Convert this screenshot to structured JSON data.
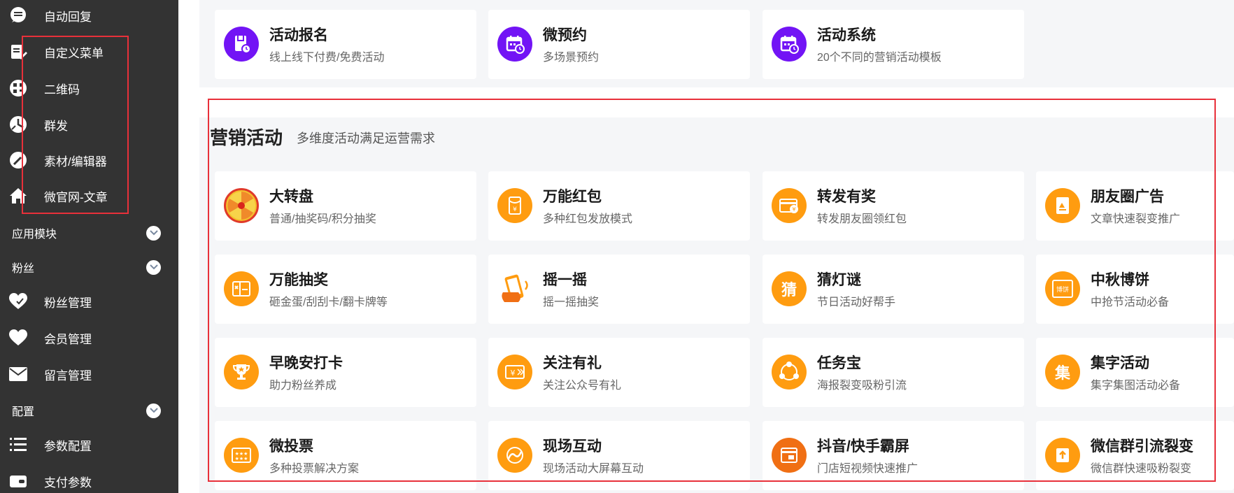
{
  "sidebar": {
    "items_top": [
      {
        "label": "自动回复",
        "icon": "message-icon"
      },
      {
        "label": "自定义菜单",
        "icon": "edit-doc-icon"
      },
      {
        "label": "二维码",
        "icon": "qrcode-icon"
      },
      {
        "label": "群发",
        "icon": "broadcast-icon"
      },
      {
        "label": "素材/编辑器",
        "icon": "pen-icon"
      },
      {
        "label": "微官网-文章",
        "icon": "home-icon"
      }
    ],
    "sections": {
      "app_modules": "应用模块",
      "fans": "粉丝",
      "config": "配置"
    },
    "fans_items": [
      {
        "label": "粉丝管理",
        "icon": "heart-check-icon"
      },
      {
        "label": "会员管理",
        "icon": "heart-icon"
      },
      {
        "label": "留言管理",
        "icon": "mail-icon"
      }
    ],
    "config_items": [
      {
        "label": "参数配置",
        "icon": "list-icon"
      },
      {
        "label": "支付参数",
        "icon": "wallet-icon"
      }
    ]
  },
  "top_cards": [
    {
      "title": "活动报名",
      "subtitle": "线上线下付费/免费活动",
      "icon": "signup-icon"
    },
    {
      "title": "微预约",
      "subtitle": "多场景预约",
      "icon": "calendar-icon"
    },
    {
      "title": "活动系统",
      "subtitle": "20个不同的营销活动模板",
      "icon": "calendar-clock-icon"
    }
  ],
  "marketing": {
    "title": "营销活动",
    "subtitle": "多维度活动满足运营需求",
    "cards": [
      {
        "title": "大转盘",
        "subtitle": "普通/抽奖码/积分抽奖",
        "icon": "wheel-icon"
      },
      {
        "title": "万能红包",
        "subtitle": "多种红包发放模式",
        "icon": "red-packet-icon"
      },
      {
        "title": "转发有奖",
        "subtitle": "转发朋友圈领红包",
        "icon": "share-reward-icon"
      },
      {
        "title": "朋友圈广告",
        "subtitle": "文章快速裂变推广",
        "icon": "ad-icon"
      },
      {
        "title": "万能抽奖",
        "subtitle": "砸金蛋/刮刮卡/翻卡牌等",
        "icon": "lottery-icon"
      },
      {
        "title": "摇一摇",
        "subtitle": "摇一摇抽奖",
        "icon": "shake-phone-icon"
      },
      {
        "title": "猜灯谜",
        "subtitle": "节日活动好帮手",
        "icon": "riddle-icon"
      },
      {
        "title": "中秋博饼",
        "subtitle": "中抢节活动必备",
        "icon": "mooncake-icon"
      },
      {
        "title": "早晚安打卡",
        "subtitle": "助力粉丝养成",
        "icon": "trophy-icon"
      },
      {
        "title": "关注有礼",
        "subtitle": "关注公众号有礼",
        "icon": "gift-ticket-icon"
      },
      {
        "title": "任务宝",
        "subtitle": "海报裂变吸粉引流",
        "icon": "network-icon"
      },
      {
        "title": "集字活动",
        "subtitle": "集字集图活动必备",
        "icon": "collect-char-icon"
      },
      {
        "title": "微投票",
        "subtitle": "多种投票解决方案",
        "icon": "vote-icon"
      },
      {
        "title": "现场互动",
        "subtitle": "现场活动大屏幕互动",
        "icon": "live-icon"
      },
      {
        "title": "抖音/快手霸屏",
        "subtitle": "门店短视频快速推广",
        "icon": "video-icon"
      },
      {
        "title": "微信群引流裂变",
        "subtitle": "微信群快速吸粉裂变",
        "icon": "group-upload-icon"
      }
    ]
  },
  "icon_glyphs": {
    "riddle": "猜",
    "collect": "集",
    "mooncake": "博饼"
  },
  "colors": {
    "sidebar_bg": "#333333",
    "purple_icon": "#7214f5",
    "orange_icon": "#ff9c10",
    "highlight_border": "#e8303a"
  }
}
